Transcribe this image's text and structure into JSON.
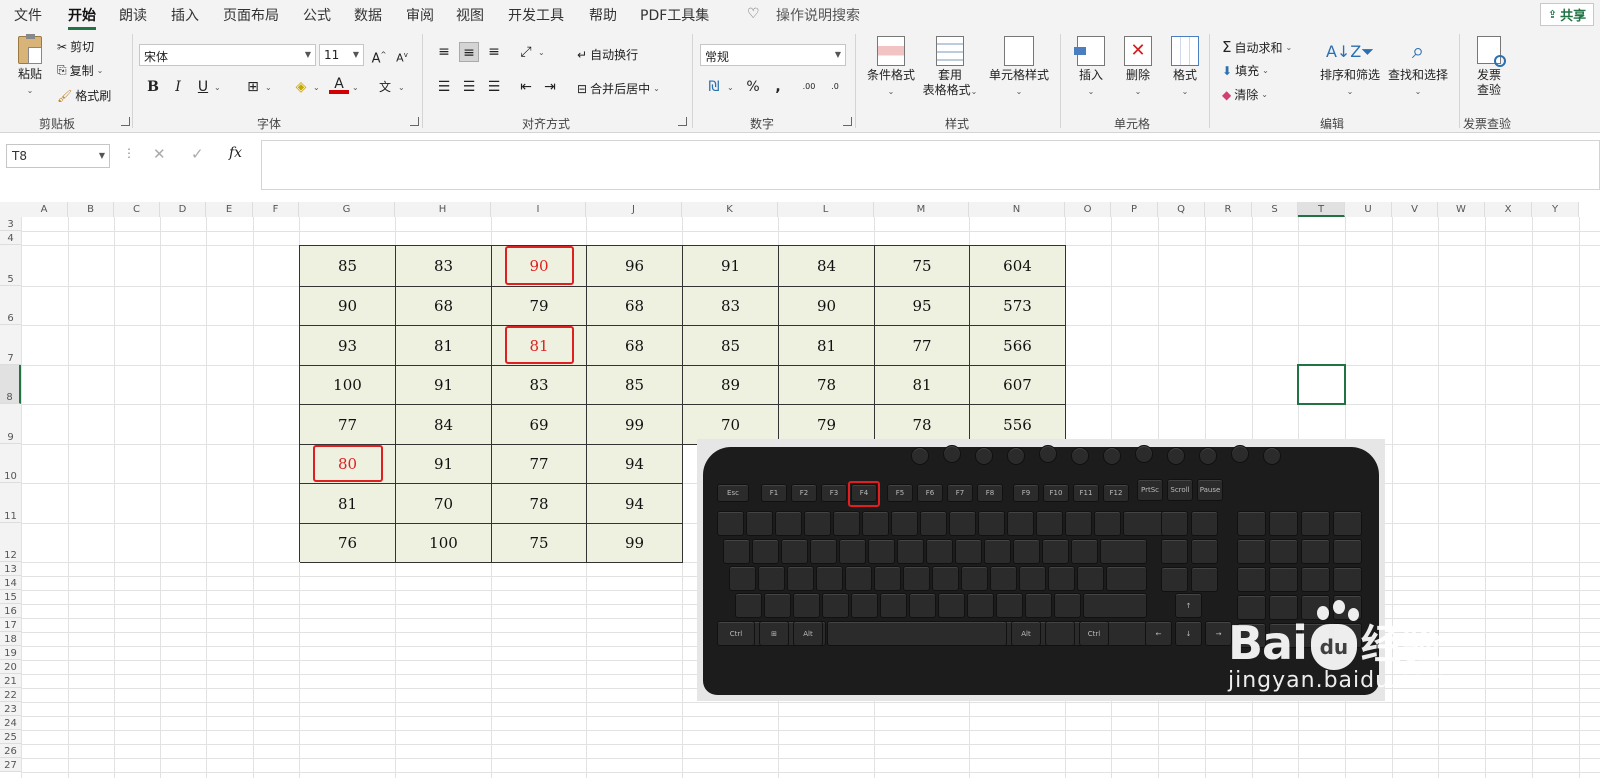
{
  "menu": {
    "tabs": [
      "文件",
      "开始",
      "朗读",
      "插入",
      "页面布局",
      "公式",
      "数据",
      "审阅",
      "视图",
      "开发工具",
      "帮助",
      "PDF工具集"
    ],
    "active": "开始",
    "search": "操作说明搜索",
    "share": "共享"
  },
  "ribbon": {
    "clipboard": {
      "paste": "粘贴",
      "cut": "剪切",
      "copy": "复制",
      "format_painter": "格式刷",
      "label": "剪贴板"
    },
    "font": {
      "name": "宋体",
      "size": "11",
      "label": "字体"
    },
    "alignment": {
      "wrap": "自动换行",
      "merge": "合并后居中",
      "label": "对齐方式"
    },
    "number": {
      "format": "常规",
      "label": "数字"
    },
    "styles": {
      "conditional": "条件格式",
      "table_fmt_1": "套用",
      "table_fmt_2": "表格格式",
      "cell_styles": "单元格样式",
      "label": "样式"
    },
    "cells": {
      "insert": "插入",
      "delete": "删除",
      "format": "格式",
      "label": "单元格"
    },
    "editing": {
      "autosum": "自动求和",
      "fill": "填充",
      "clear": "清除",
      "sort": "排序和筛选",
      "find": "查找和选择",
      "label": "编辑"
    },
    "invoice": {
      "line1": "发票",
      "line2": "查验",
      "label": "发票查验"
    }
  },
  "formula_bar": {
    "name_box": "T8",
    "fx": "fx",
    "value": ""
  },
  "grid": {
    "columns": [
      "A",
      "B",
      "C",
      "D",
      "E",
      "F",
      "G",
      "H",
      "I",
      "J",
      "K",
      "L",
      "M",
      "N",
      "O",
      "P",
      "Q",
      "R",
      "S",
      "T",
      "U",
      "V",
      "W",
      "X",
      "Y"
    ],
    "rows": [
      "3",
      "4",
      "5",
      "6",
      "7",
      "8",
      "9",
      "10",
      "11",
      "12",
      "13",
      "14",
      "15",
      "16",
      "17",
      "18",
      "19",
      "20",
      "21",
      "22",
      "23",
      "24",
      "25",
      "26",
      "27"
    ],
    "selected_cell": "T8"
  },
  "table": [
    [
      "85",
      "83",
      "90",
      "96",
      "91",
      "84",
      "75",
      "604"
    ],
    [
      "90",
      "68",
      "79",
      "68",
      "83",
      "90",
      "95",
      "573"
    ],
    [
      "93",
      "81",
      "81",
      "68",
      "85",
      "81",
      "77",
      "566"
    ],
    [
      "100",
      "91",
      "83",
      "85",
      "89",
      "78",
      "81",
      "607"
    ],
    [
      "77",
      "84",
      "69",
      "99",
      "70",
      "79",
      "78",
      "556"
    ],
    [
      "80",
      "91",
      "77",
      "94"
    ],
    [
      "81",
      "70",
      "78",
      "94"
    ],
    [
      "76",
      "100",
      "75",
      "99"
    ]
  ],
  "highlighted_cells": [
    "I5",
    "I7",
    "G10"
  ],
  "keyboard": {
    "highlight_key": "F4"
  },
  "watermark": {
    "brand": "Bai",
    "du": "du",
    "cn": "经验",
    "url": "jingyan.baidu.com"
  },
  "colors": {
    "accent": "#217346",
    "highlight": "#e02020",
    "cell_fill": "#eef0e0"
  }
}
